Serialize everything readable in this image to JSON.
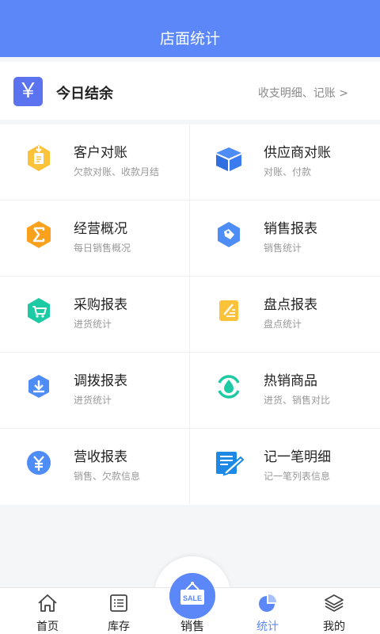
{
  "header": {
    "title": "店面统计"
  },
  "today": {
    "icon": "yuan-icon",
    "symbol": "￥",
    "label": "今日结余",
    "link": "收支明细、记账 >"
  },
  "items": [
    {
      "name": "客户对账",
      "sub": "欠款对账、收款月结",
      "icon": "customer-ledger-icon"
    },
    {
      "name": "供应商对账",
      "sub": "对账、付款",
      "icon": "supplier-box-icon"
    },
    {
      "name": "经营概况",
      "sub": "每日销售概况",
      "icon": "sigma-hexagon-icon"
    },
    {
      "name": "销售报表",
      "sub": "销售统计",
      "icon": "price-tag-icon"
    },
    {
      "name": "采购报表",
      "sub": "进货统计",
      "icon": "cart-hexagon-icon"
    },
    {
      "name": "盘点报表",
      "sub": "盘点统计",
      "icon": "inventory-note-icon"
    },
    {
      "name": "调拨报表",
      "sub": "进货统计",
      "icon": "transfer-download-icon"
    },
    {
      "name": "热销商品",
      "sub": "进货、销售对比",
      "icon": "hot-drop-icon"
    },
    {
      "name": "营收报表",
      "sub": "销售、欠款信息",
      "icon": "yuan-circle-icon"
    },
    {
      "name": "记一笔明细",
      "sub": "记一笔列表信息",
      "icon": "note-pen-icon"
    }
  ],
  "tabs": [
    {
      "label": "首页",
      "icon": "home-icon",
      "active": false
    },
    {
      "label": "库存",
      "icon": "inventory-list-icon",
      "active": false
    },
    {
      "label": "销售",
      "icon": "sale-sign-icon",
      "active": false,
      "badge_text": "SALE"
    },
    {
      "label": "统计",
      "icon": "pie-chart-icon",
      "active": true
    },
    {
      "label": "我的",
      "icon": "layers-icon",
      "active": false
    }
  ],
  "colors": {
    "primary": "#5b87f8",
    "yellow": "#fcc23a",
    "orange": "#f9a11c",
    "teal": "#1ccaa3",
    "blue": "#4e8cf6",
    "indigo": "#5c73f0"
  }
}
